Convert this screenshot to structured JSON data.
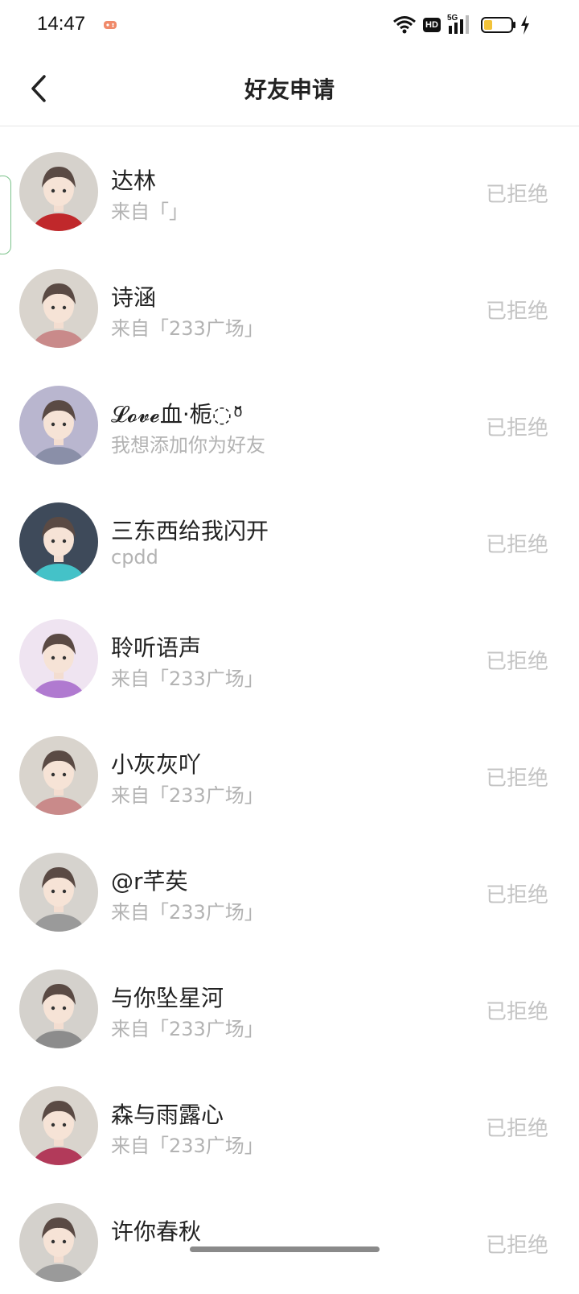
{
  "status_bar": {
    "time": "14:47",
    "icons": [
      "game-icon",
      "wifi-icon",
      "hd-icon",
      "5g-signal-icon",
      "battery-icon",
      "charging-icon"
    ],
    "hd_label": "HD",
    "network_label": "5G",
    "battery_level": 0.3,
    "battery_color": "#f2c33a"
  },
  "nav": {
    "back_icon": "chevron-left-icon",
    "title": "好友申请"
  },
  "requests": [
    {
      "name": "达林",
      "subtitle": "来自「」",
      "status": "已拒绝",
      "avatar_bg": "#d6d2cc",
      "accent": "#c0282b"
    },
    {
      "name": "诗涵",
      "subtitle": "来自「233广场」",
      "status": "已拒绝",
      "avatar_bg": "#d9d4cd",
      "accent": "#c98a8a"
    },
    {
      "name": "𝓛𝓸𝓿𝓮血·栀◌ ͦ̆̈",
      "subtitle": "我想添加你为好友",
      "status": "已拒绝",
      "avatar_bg": "#b9b6cf",
      "accent": "#8a8fa8"
    },
    {
      "name": "三东西给我闪开",
      "subtitle": "cpdd",
      "status": "已拒绝",
      "avatar_bg": "#3e4a5a",
      "accent": "#44c2c8"
    },
    {
      "name": "聆听语声",
      "subtitle": "来自「233广场」",
      "status": "已拒绝",
      "avatar_bg": "#efe4f1",
      "accent": "#b07ad0"
    },
    {
      "name": "小灰灰吖",
      "subtitle": "来自「233广场」",
      "status": "已拒绝",
      "avatar_bg": "#d9d4cd",
      "accent": "#c98a8a"
    },
    {
      "name": "@r芊䒨",
      "subtitle": "来自「233广场」",
      "status": "已拒绝",
      "avatar_bg": "#d6d3ce",
      "accent": "#9a9a9a"
    },
    {
      "name": "与你坠星河",
      "subtitle": "来自「233广场」",
      "status": "已拒绝",
      "avatar_bg": "#d4d1cc",
      "accent": "#8c8c8c"
    },
    {
      "name": "森与雨露心",
      "subtitle": "来自「233广场」",
      "status": "已拒绝",
      "avatar_bg": "#d9d4cd",
      "accent": "#b23a5a"
    },
    {
      "name": "许你春秋",
      "subtitle": "",
      "status": "已拒绝",
      "avatar_bg": "#d4d1cc",
      "accent": "#9a9a9a"
    }
  ]
}
